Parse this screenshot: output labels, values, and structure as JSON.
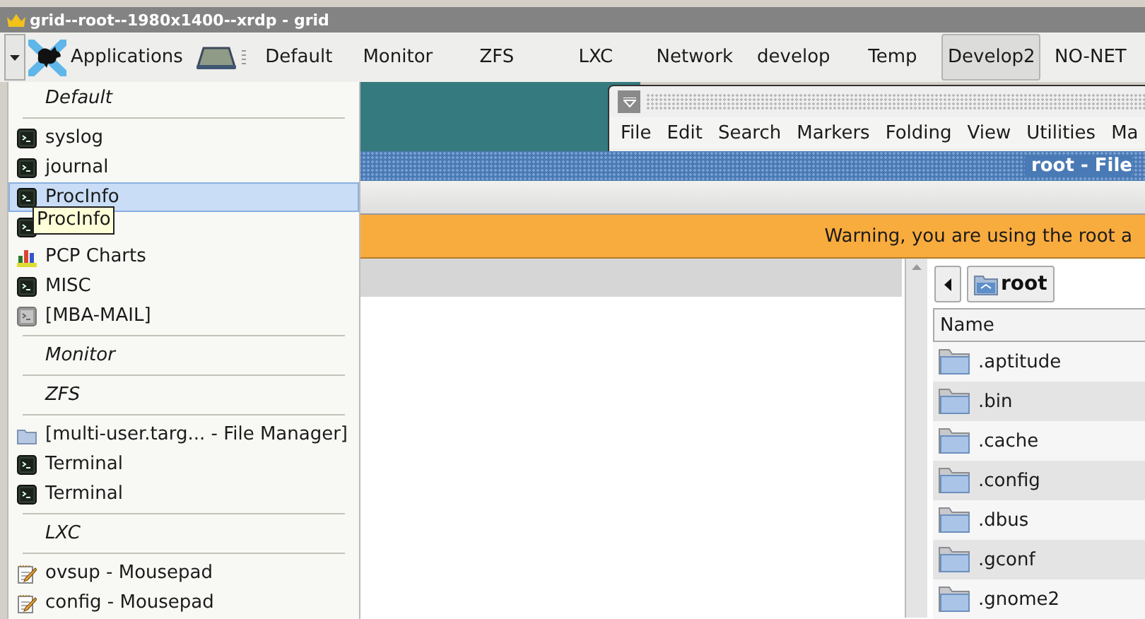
{
  "title_bar": {
    "title": "grid--root--1980x1400--xrdp - grid"
  },
  "panel": {
    "app_menu_label": "Applications",
    "workspaces": [
      {
        "label": "Default",
        "selected": false
      },
      {
        "label": "Monitor",
        "selected": false
      },
      {
        "label": "ZFS",
        "selected": false
      },
      {
        "label": "LXC",
        "selected": false
      },
      {
        "label": "Network",
        "selected": false
      },
      {
        "label": "develop",
        "selected": false
      },
      {
        "label": "Temp",
        "selected": false
      },
      {
        "label": "Develop2",
        "selected": true
      },
      {
        "label": "NO-NET",
        "selected": false
      }
    ]
  },
  "menu": {
    "items": [
      {
        "kind": "header",
        "label": "Default"
      },
      {
        "kind": "separator"
      },
      {
        "kind": "terminal",
        "label": "syslog",
        "selected": false
      },
      {
        "kind": "terminal",
        "label": "journal",
        "selected": false
      },
      {
        "kind": "terminal",
        "label": "ProcInfo",
        "selected": true
      },
      {
        "kind": "terminal",
        "selected": false
      },
      {
        "kind": "chart",
        "label": "PCP Charts",
        "selected": false
      },
      {
        "kind": "terminal",
        "label": "MISC",
        "selected": false
      },
      {
        "kind": "inactive",
        "label": "[MBA-MAIL]",
        "selected": false
      },
      {
        "kind": "separator"
      },
      {
        "kind": "header",
        "label": "Monitor"
      },
      {
        "kind": "separator"
      },
      {
        "kind": "header",
        "label": "ZFS"
      },
      {
        "kind": "separator"
      },
      {
        "kind": "folder",
        "label": "[multi-user.targ... - File Manager]",
        "selected": false
      },
      {
        "kind": "terminal",
        "label": "Terminal",
        "selected": false
      },
      {
        "kind": "terminal",
        "label": "Terminal",
        "selected": false
      },
      {
        "kind": "separator"
      },
      {
        "kind": "header",
        "label": "LXC"
      },
      {
        "kind": "separator"
      },
      {
        "kind": "notepad",
        "label": "ovsup - Mousepad",
        "selected": false
      },
      {
        "kind": "notepad",
        "label": "config - Mousepad",
        "selected": false
      }
    ]
  },
  "tooltip": {
    "text": "ProcInfo"
  },
  "editor": {
    "menus": [
      "File",
      "Edit",
      "Search",
      "Markers",
      "Folding",
      "View",
      "Utilities",
      "Ma"
    ]
  },
  "file_manager": {
    "title": "root - File",
    "warning": "Warning, you are using the root a",
    "path_button": "root",
    "column": "Name",
    "rows": [
      ".aptitude",
      ".bin",
      ".cache",
      ".config",
      ".dbus",
      ".gconf",
      ".gnome2"
    ]
  }
}
